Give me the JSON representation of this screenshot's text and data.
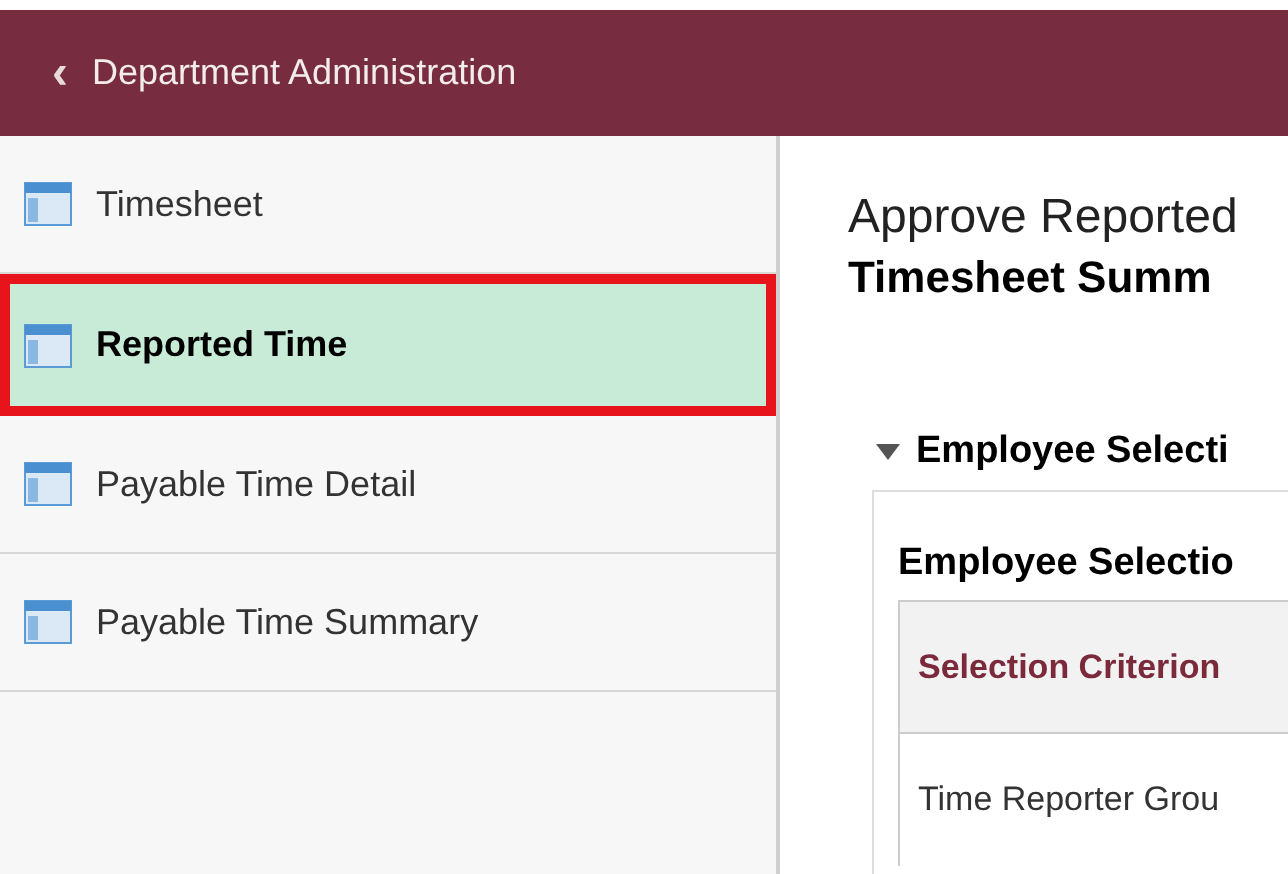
{
  "header": {
    "back_icon": "‹",
    "title": "Department Administration"
  },
  "sidebar": {
    "items": [
      {
        "label": "Timesheet",
        "selected": false,
        "highlighted": false
      },
      {
        "label": "Reported Time",
        "selected": true,
        "highlighted": true
      },
      {
        "label": "Payable Time Detail",
        "selected": false,
        "highlighted": false
      },
      {
        "label": "Payable Time Summary",
        "selected": false,
        "highlighted": false
      }
    ]
  },
  "main": {
    "title": "Approve Reported",
    "subtitle": "Timesheet Summ",
    "section": {
      "title": "Employee Selecti",
      "expanded": true,
      "grid_title": "Employee Selectio",
      "table": {
        "columns": [
          "Selection Criterion"
        ],
        "rows": [
          [
            "Time Reporter Grou"
          ]
        ]
      }
    }
  }
}
